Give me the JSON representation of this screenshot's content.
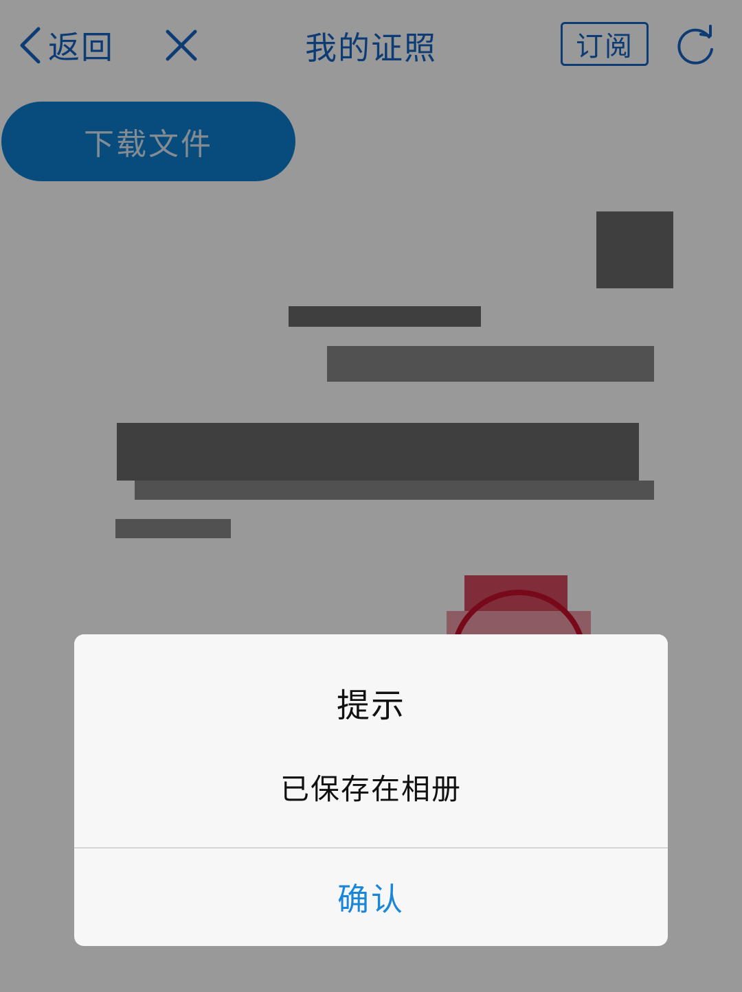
{
  "navbar": {
    "back_label": "返回",
    "title": "我的证照",
    "subscribe_label": "订阅"
  },
  "toolbar": {
    "download_label": "下载文件"
  },
  "dialog": {
    "title": "提示",
    "message": "已保存在相册",
    "confirm_label": "确认"
  },
  "colors": {
    "accent": "#1565c0",
    "download_button": "#0e7fd0",
    "confirm_text": "#1a86d8",
    "seal_red": "#c8102e"
  },
  "icons": {
    "back": "chevron-left-icon",
    "close": "close-icon",
    "refresh": "refresh-icon"
  }
}
